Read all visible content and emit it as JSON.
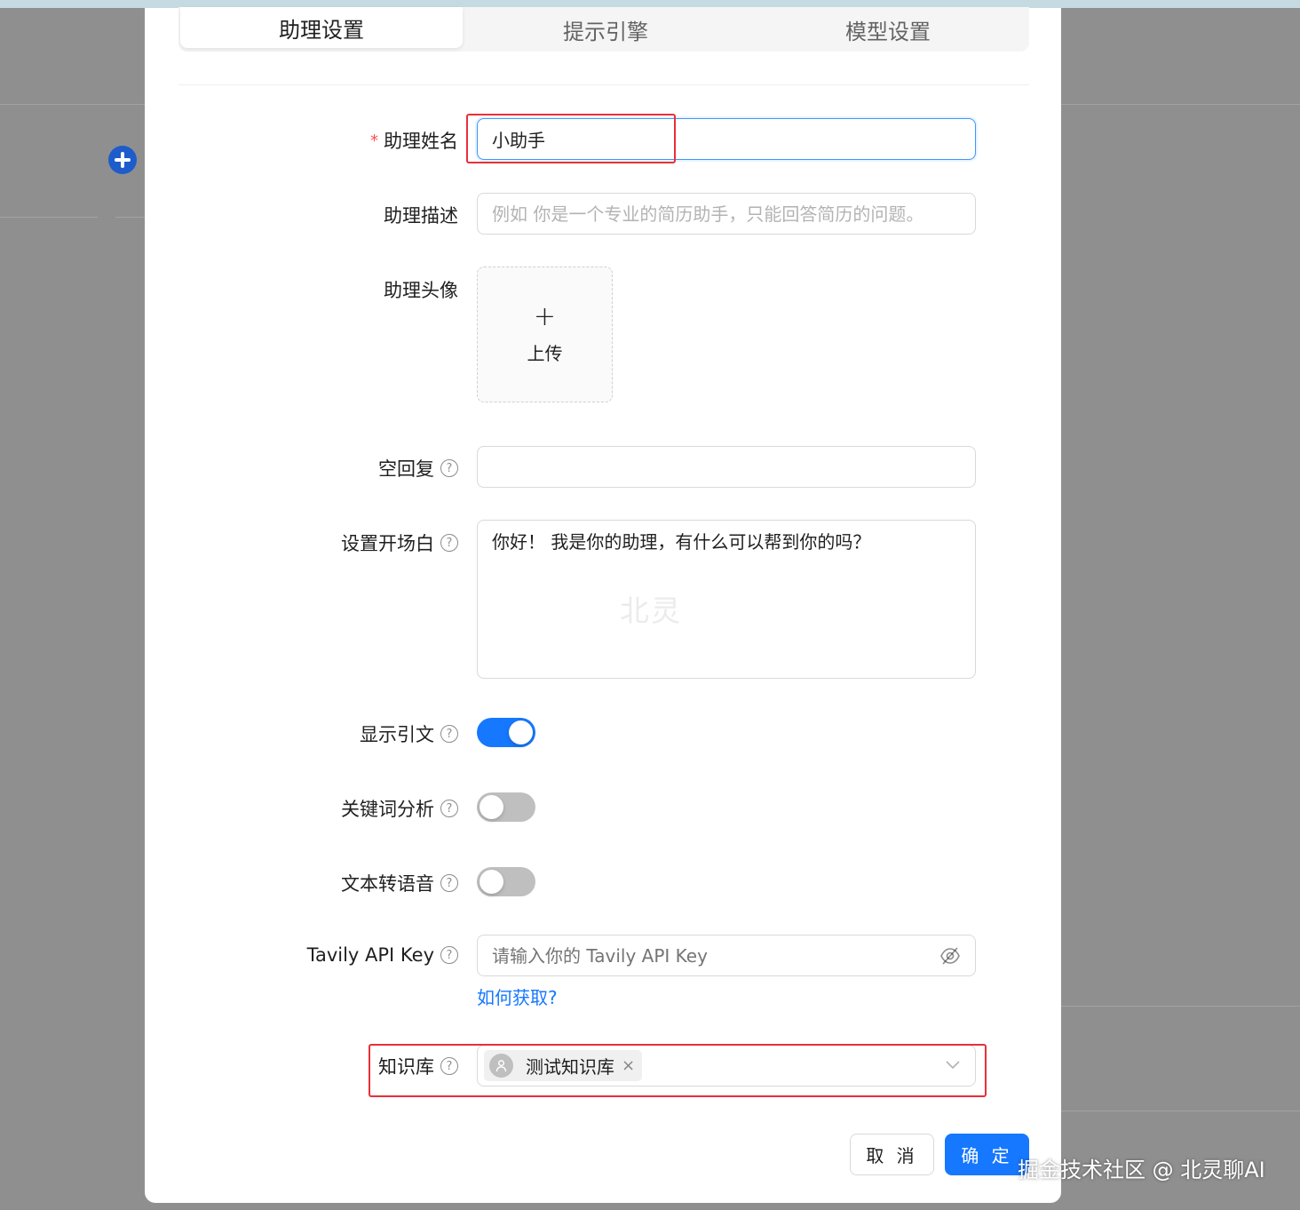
{
  "tabs": [
    "助理设置",
    "提示引擎",
    "模型设置"
  ],
  "form": {
    "name": {
      "label": "助理姓名",
      "required_mark": "*",
      "value": "小助手"
    },
    "description": {
      "label": "助理描述",
      "placeholder": "例如 你是一个专业的简历助手，只能回答简历的问题。"
    },
    "avatar": {
      "label": "助理头像",
      "plus_glyph": "+",
      "upload_label": "上传"
    },
    "empty_reply": {
      "label": "空回复",
      "value": ""
    },
    "opening": {
      "label": "设置开场白",
      "value": "你好！ 我是你的助理，有什么可以帮到你的吗？"
    },
    "show_citation": {
      "label": "显示引文",
      "on": true
    },
    "keyword_analysis": {
      "label": "关键词分析",
      "on": false
    },
    "tts": {
      "label": "文本转语音",
      "on": false
    },
    "tavily": {
      "label": "Tavily API Key",
      "placeholder": "请输入你的 Tavily API Key",
      "help_link": "如何获取?"
    },
    "knowledge_base": {
      "label": "知识库",
      "selected": "测试知识库",
      "close_glyph": "×"
    }
  },
  "help_glyph": "?",
  "buttons": {
    "cancel": "取 消",
    "ok": "确 定"
  },
  "watermarks": {
    "center": "北灵",
    "corner": "掘金技术社区 @ 北灵聊AI"
  },
  "colors": {
    "primary": "#1677ff",
    "highlight_box": "#e8303a",
    "required": "#ff4d4f"
  }
}
